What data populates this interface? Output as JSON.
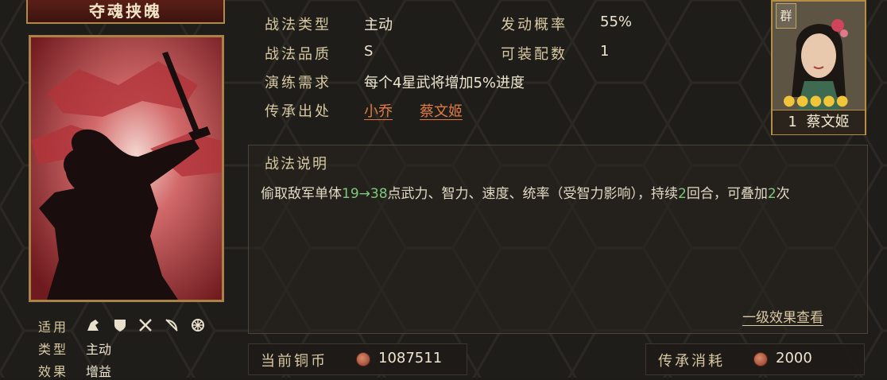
{
  "skill": {
    "name": "夺魂挟魄"
  },
  "attributes": {
    "type_label": "战法类型",
    "type_value": "主动",
    "rate_label": "发动概率",
    "rate_value": "55%",
    "quality_label": "战法品质",
    "quality_value": "S",
    "equip_label": "可装配数",
    "equip_value": "1",
    "train_label": "演练需求",
    "train_value": "每个4星武将增加5%进度",
    "source_label": "传承出处",
    "source_links": [
      "小乔",
      "蔡文姬"
    ]
  },
  "description": {
    "title": "战法说明",
    "text_part1": "偷取敌军单体",
    "range": "19→38",
    "text_part2": "点武力、智力、速度、统率（受智力影响），持续",
    "duration": "2",
    "text_part3": "回合，可叠加",
    "stacks": "2",
    "text_part4": "次",
    "effect_link": "一级效果查看"
  },
  "card_meta": {
    "applicable_label": "适用",
    "applicable_icons": [
      "cavalry-icon",
      "shield-icon",
      "crossed-swords-icon",
      "bow-icon",
      "wheel-icon"
    ],
    "kind_label": "类型",
    "kind_value": "主动",
    "effect_label": "效果",
    "effect_value": "增益"
  },
  "general": {
    "faction": "群",
    "level": "1",
    "name": "蔡文姬",
    "stars": 5
  },
  "footer": {
    "coins_label": "当前铜币",
    "coins_value": "1087511",
    "cost_label": "传承消耗",
    "cost_value": "2000"
  },
  "colors": {
    "accent_gold": "#b08848",
    "link_orange": "#e07a44",
    "highlight_green": "#7cc97a",
    "card_red": "#8a2a2a"
  }
}
